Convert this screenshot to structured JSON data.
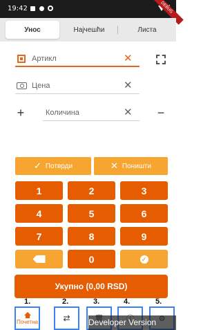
{
  "status_bar": {
    "time": "19:42",
    "debug_ribbon": "DEBUG",
    "icons": [
      "notification-icon",
      "dot-icon",
      "sync-icon",
      "wifi-icon",
      "battery-icon"
    ]
  },
  "tabs": [
    {
      "label": "Унос",
      "active": true
    },
    {
      "label": "Најчешћи",
      "active": false
    },
    {
      "label": "Листа",
      "active": false
    }
  ],
  "form": {
    "article_placeholder": "Артикл",
    "price_placeholder": "Цена",
    "quantity_placeholder": "Количина",
    "clear_symbol": "✕",
    "plus_symbol": "+",
    "minus_symbol": "−"
  },
  "actions": {
    "confirm_label": "Потврди",
    "cancel_label": "Поништи"
  },
  "keypad": {
    "keys": [
      "1",
      "2",
      "3",
      "4",
      "5",
      "6",
      "7",
      "8",
      "9",
      "backspace",
      "0",
      "confirm"
    ]
  },
  "total_label": "Укупно (0,00 RSD)",
  "bottom_nav": {
    "numbers": [
      "1.",
      "2.",
      "3.",
      "4.",
      "5."
    ],
    "home_label": "Почетна"
  },
  "developer_banner": "Developer Version",
  "colors": {
    "accent": "#e65c00",
    "accent_light": "#f6a630",
    "nav_outline": "#3b82f6"
  }
}
